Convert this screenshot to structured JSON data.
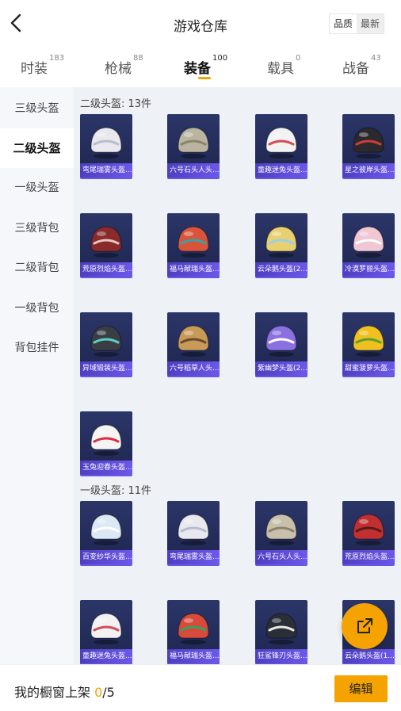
{
  "header": {
    "title": "游戏仓库",
    "back_icon": "chevron-left-icon",
    "sort": [
      "品质",
      "最新"
    ]
  },
  "tabs": [
    {
      "label": "时装",
      "count": "183"
    },
    {
      "label": "枪械",
      "count": "88"
    },
    {
      "label": "装备",
      "count": "100",
      "active": true
    },
    {
      "label": "载具",
      "count": "0"
    },
    {
      "label": "战备",
      "count": "43"
    }
  ],
  "sidebar": [
    {
      "label": "三级头盔"
    },
    {
      "label": "二级头盔",
      "active": true
    },
    {
      "label": "一级头盔"
    },
    {
      "label": "三级背包"
    },
    {
      "label": "二级背包"
    },
    {
      "label": "一级背包"
    },
    {
      "label": "背包挂件"
    }
  ],
  "sections": [
    {
      "title": "二级头盔: 13件",
      "items": [
        {
          "name": "弯尾瑞雾头盔...",
          "color": "#e8e8ee",
          "accent": "#b8bccc"
        },
        {
          "name": "六号石头人头...",
          "color": "#b9b3a0",
          "accent": "#8a846e"
        },
        {
          "name": "童趣迷兔头盔...",
          "color": "#f2f2f2",
          "accent": "#d64a5a"
        },
        {
          "name": "星之彼岸头盔...",
          "color": "#2a2a2e",
          "accent": "#d23a3a"
        },
        {
          "name": "荒原烈焰头盔...",
          "color": "#8a2a2a",
          "accent": "#e4c7c0"
        },
        {
          "name": "福马献瑞头盔...",
          "color": "#d8553a",
          "accent": "#3aa0a8"
        },
        {
          "name": "云朵鹅头盔(2...",
          "color": "#e8d070",
          "accent": "#9ad0e8"
        },
        {
          "name": "冷漠罗丽头盔...",
          "color": "#f0c8d4",
          "accent": "#ffffff"
        },
        {
          "name": "异域锻装头盔...",
          "color": "#3a3e44",
          "accent": "#5ad0c8"
        },
        {
          "name": "六号稻草人头...",
          "color": "#c89a58",
          "accent": "#6a4a2a"
        },
        {
          "name": "紫幽梦头盔(2...",
          "color": "#8a70e0",
          "accent": "#ffffff"
        },
        {
          "name": "甜蜜菠萝头盔...",
          "color": "#f0c020",
          "accent": "#5aa030"
        },
        {
          "name": "玉兔迎春头盔...",
          "color": "#f4f4f4",
          "accent": "#d83040"
        }
      ]
    },
    {
      "title": "一级头盔: 11件",
      "items": [
        {
          "name": "百变纱华头盔...",
          "color": "#dce8f4",
          "accent": "#ffffff"
        },
        {
          "name": "弯尾瑞雾头盔...",
          "color": "#e8e8ee",
          "accent": "#b8bccc"
        },
        {
          "name": "六号石头人头...",
          "color": "#c8c0aa",
          "accent": "#8a846e"
        },
        {
          "name": "荒原烈焰头盔...",
          "color": "#c03030",
          "accent": "#5a1a1a"
        },
        {
          "name": "童趣迷兔头盔...",
          "color": "#f2f2f2",
          "accent": "#d64a5a"
        },
        {
          "name": "福马献瑞头盔...",
          "color": "#d84a3a",
          "accent": "#3aa060"
        },
        {
          "name": "狂鲨锋刃头盔...",
          "color": "#2a2e36",
          "accent": "#e8e8e8"
        },
        {
          "name": "云朵鹅头盔(1...",
          "color": "#e8e0c0",
          "accent": "#9ad0e8"
        }
      ]
    }
  ],
  "fab": {
    "icon": "share-external-icon"
  },
  "footer": {
    "label": "我的橱窗上架 ",
    "current": "0",
    "total": "/5",
    "edit_label": "编辑"
  },
  "colors": {
    "accent": "#f5a300",
    "card_bg": "#232a5a",
    "card_name_bg": "#5b4bd8"
  }
}
